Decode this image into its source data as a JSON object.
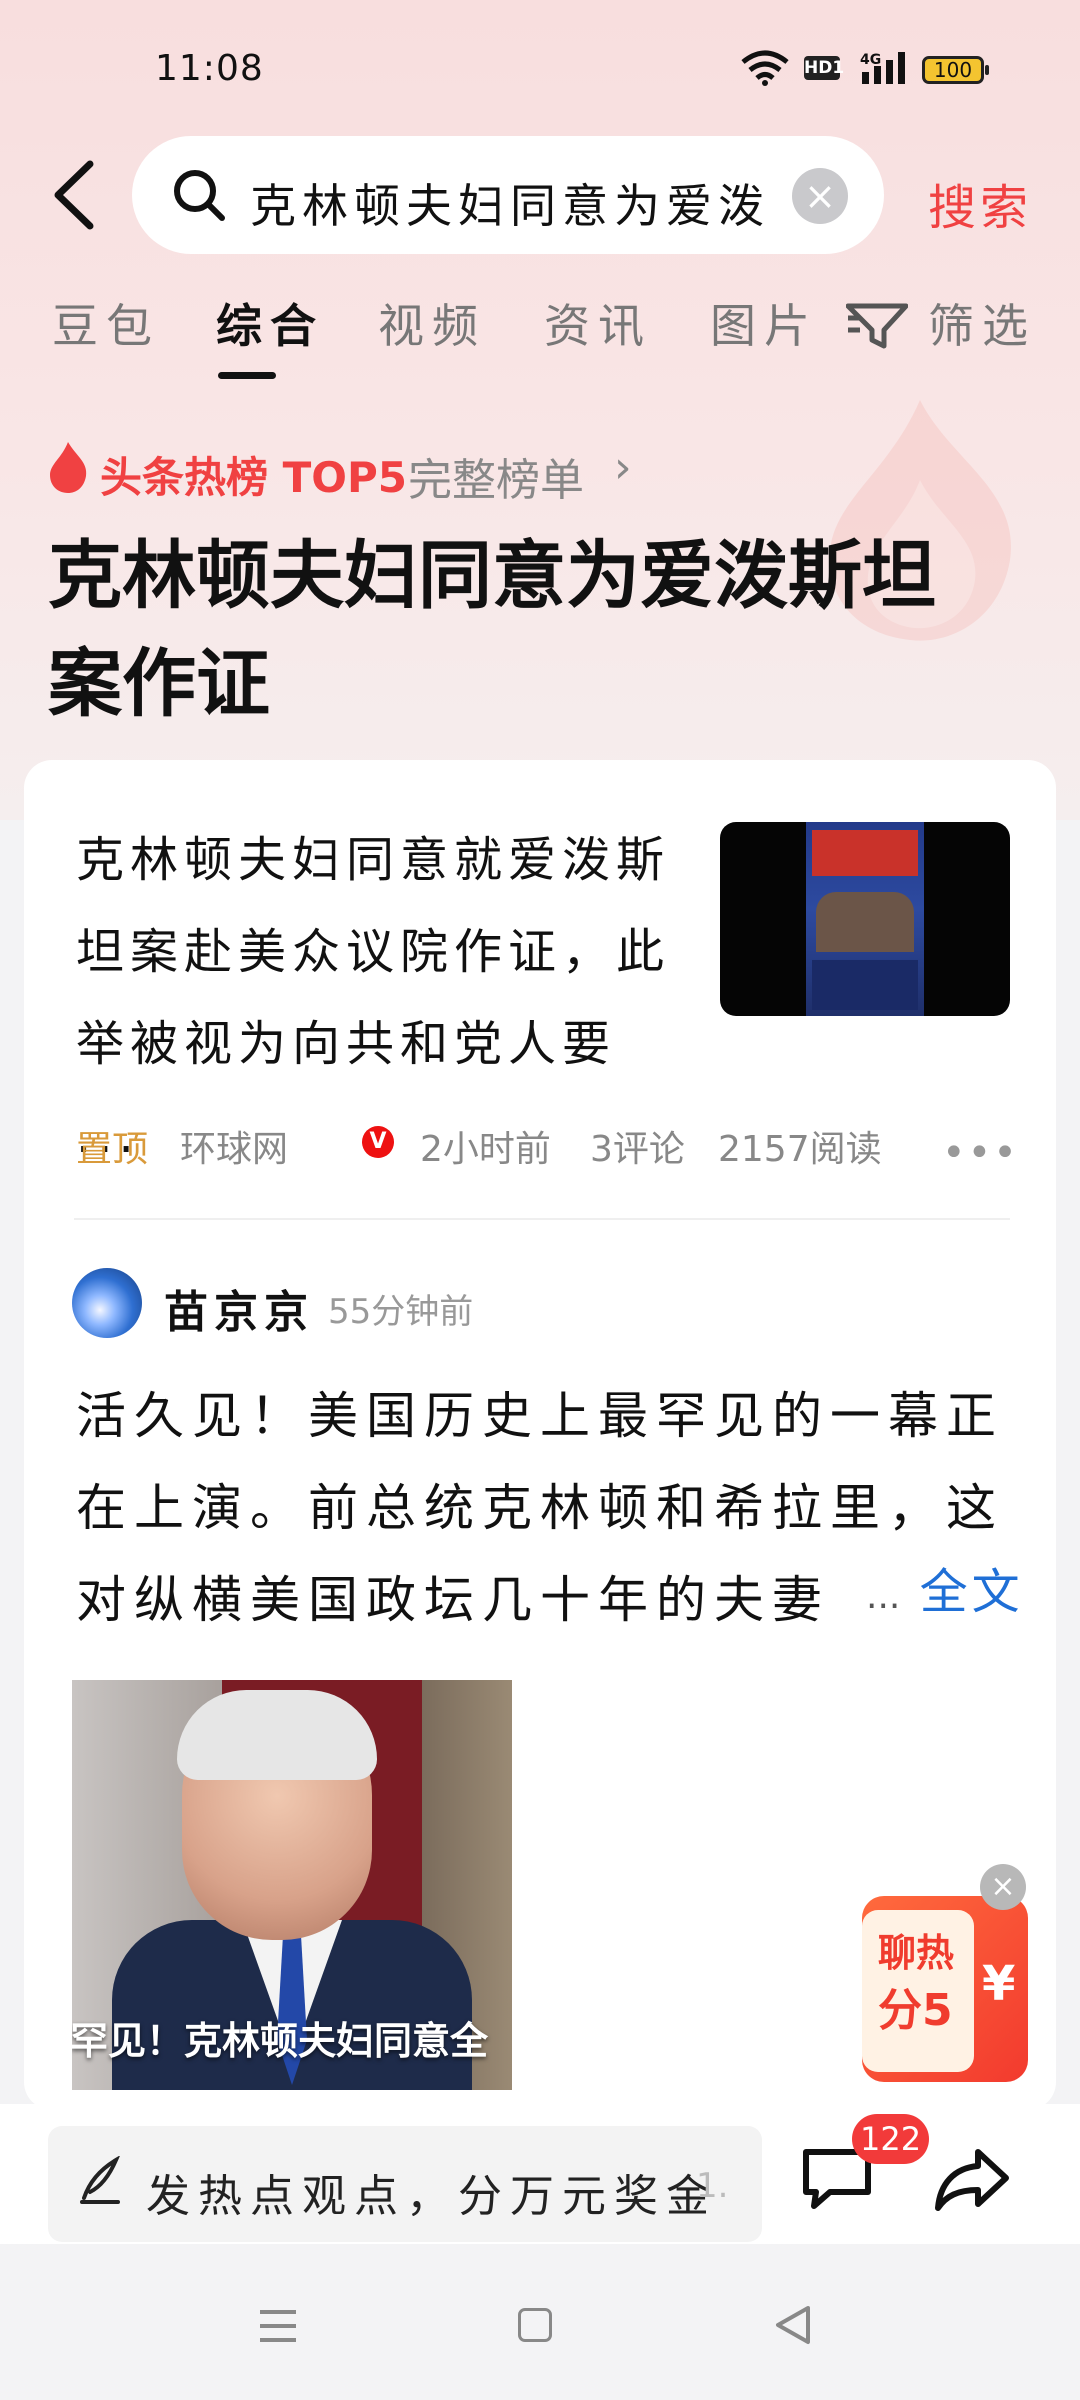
{
  "status_bar": {
    "time": "11:08",
    "network": "4G",
    "hd_label": "HD1",
    "battery": "100"
  },
  "search": {
    "query": "克林顿夫妇同意为爱泼",
    "button": "搜索"
  },
  "tabs": [
    {
      "label": "豆包",
      "active": false
    },
    {
      "label": "综合",
      "active": true
    },
    {
      "label": "视频",
      "active": false
    },
    {
      "label": "资讯",
      "active": false
    },
    {
      "label": "图片",
      "active": false
    },
    {
      "label": "筛选",
      "active": false
    }
  ],
  "hot": {
    "label": "头条热榜 TOP5",
    "full_list": "完整榜单",
    "title": "克林顿夫妇同意为爱泼斯坦案作证"
  },
  "news": {
    "text": "克林顿夫妇同意就爱泼斯坦案赴美众议院作证，此举被视为向共和党人要 ...",
    "pin": "置顶",
    "source": "环球网",
    "verified": "V",
    "time": "2小时前",
    "comments": "3评论",
    "reads": "2157阅读"
  },
  "post": {
    "author": "苗京京",
    "time": "55分钟前",
    "text": "活久见！美国历史上最罕见的一幕正在上演。前总统克林顿和希拉里，这对纵横美国政坛几十年的夫妻",
    "ellipsis": "...",
    "full_text": "全文",
    "image_caption": "罕见！克林顿夫妇同意全"
  },
  "packet": {
    "line1": "聊热",
    "line2": "分5",
    "symbol": "¥",
    "close": "×"
  },
  "bottom": {
    "comment_prompt": "发热点观点，分万元奖金",
    "comment_more": "1.",
    "comment_count": "122"
  },
  "colors": {
    "accent": "#f04142",
    "link": "#1f6fd6",
    "pin": "#d99a3a"
  }
}
